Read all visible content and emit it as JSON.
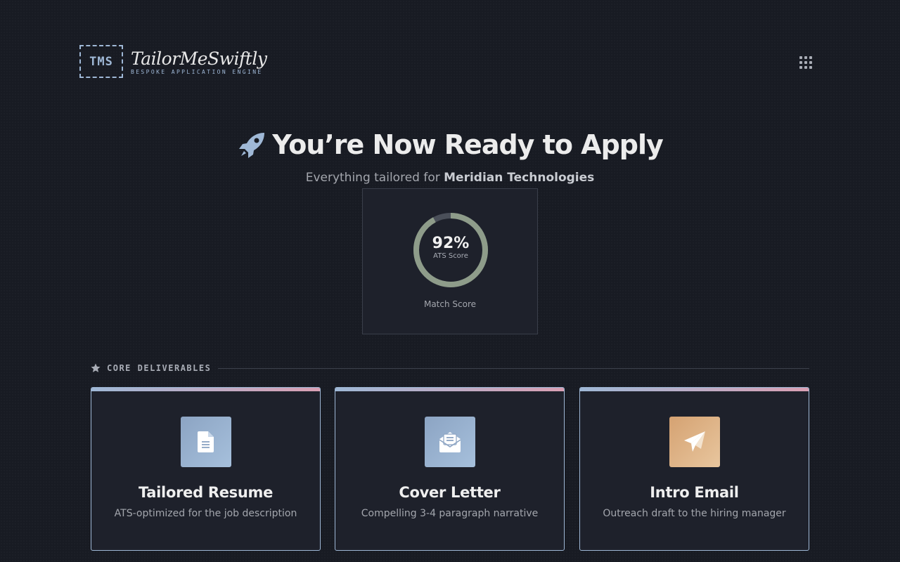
{
  "header": {
    "logo_mark": "TMS",
    "app_name": "TailorMeSwiftly",
    "tagline": "BESPOKE APPLICATION ENGINE",
    "menu_icon": "grid-icon"
  },
  "hero": {
    "icon": "rocket-icon",
    "title": "You’re Now Ready to Apply",
    "subtitle_prefix": "Everything tailored for",
    "company": "Meridian Technologies"
  },
  "score": {
    "value": 92,
    "value_label": "92%",
    "sub_label": "ATS Score",
    "caption": "Match Score",
    "ring_color": "#8e9c8a",
    "track_color": "#4a4f59"
  },
  "section": {
    "icon": "star-icon",
    "label": "CORE DELIVERABLES"
  },
  "cards": [
    {
      "icon": "document-icon",
      "title": "Tailored Resume",
      "description": "ATS-optimized for the job description"
    },
    {
      "icon": "envelope-open-icon",
      "title": "Cover Letter",
      "description": "Compelling 3-4 paragraph narrative"
    },
    {
      "icon": "paper-plane-icon",
      "title": "Intro Email",
      "description": "Outreach draft to the hiring manager"
    }
  ],
  "colors": {
    "background": "#181b23",
    "card": "#1e212b",
    "accent_blue": "#9fb8d6",
    "accent_pink": "#d9a0b4",
    "accent_orange": "#d5a272"
  }
}
